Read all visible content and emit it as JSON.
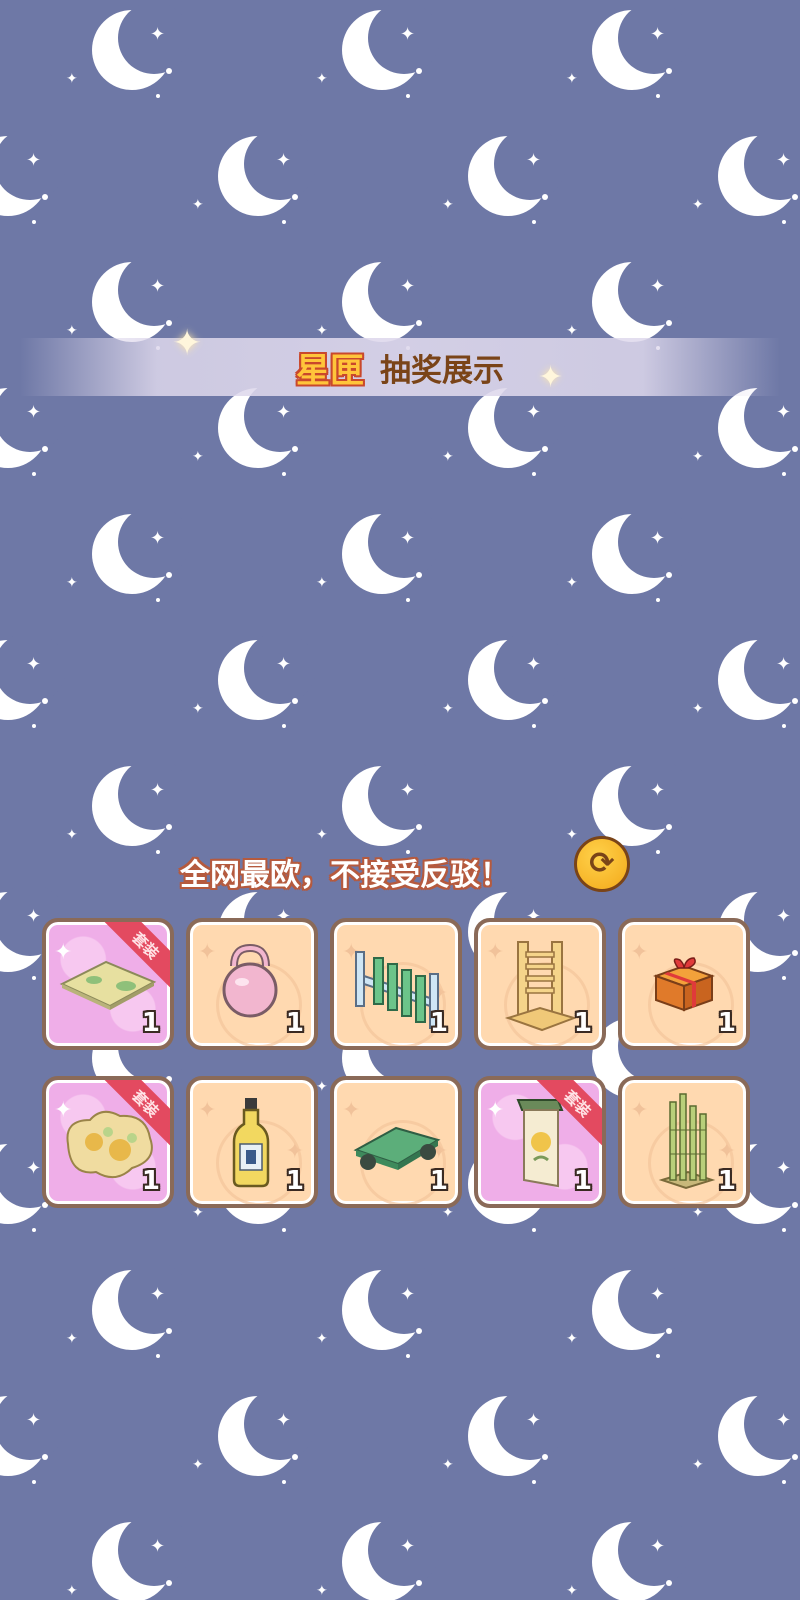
{
  "title": {
    "brand": "星匣",
    "text": "抽奖展示"
  },
  "slogan": "全网最欧，不接受反驳！",
  "refresh_button": {
    "icon": "refresh-icon"
  },
  "background": {
    "color": "#6e78a6",
    "pattern_icon": "crescent-moon-icon"
  },
  "items": [
    {
      "name": "green mat",
      "icon": "mat-icon",
      "quantity": "1",
      "suit": true,
      "badge": "套装"
    },
    {
      "name": "pink kettlebell",
      "icon": "kettlebell-icon",
      "quantity": "1",
      "suit": false
    },
    {
      "name": "green fence",
      "icon": "fence-icon",
      "quantity": "1",
      "suit": false
    },
    {
      "name": "wooden shelf",
      "icon": "wooden-rack-icon",
      "quantity": "1",
      "suit": false
    },
    {
      "name": "gift box",
      "icon": "gift-box-icon",
      "quantity": "1",
      "suit": false
    },
    {
      "name": "golden rug",
      "icon": "rug-icon",
      "quantity": "1",
      "suit": true,
      "badge": "套装"
    },
    {
      "name": "bottle",
      "icon": "bottle-icon",
      "quantity": "1",
      "suit": false
    },
    {
      "name": "green sign",
      "icon": "sign-board-icon",
      "quantity": "1",
      "suit": false
    },
    {
      "name": "hanging scroll",
      "icon": "scroll-banner-icon",
      "quantity": "1",
      "suit": true,
      "badge": "套装"
    },
    {
      "name": "bamboo",
      "icon": "bamboo-icon",
      "quantity": "1",
      "suit": false
    }
  ]
}
